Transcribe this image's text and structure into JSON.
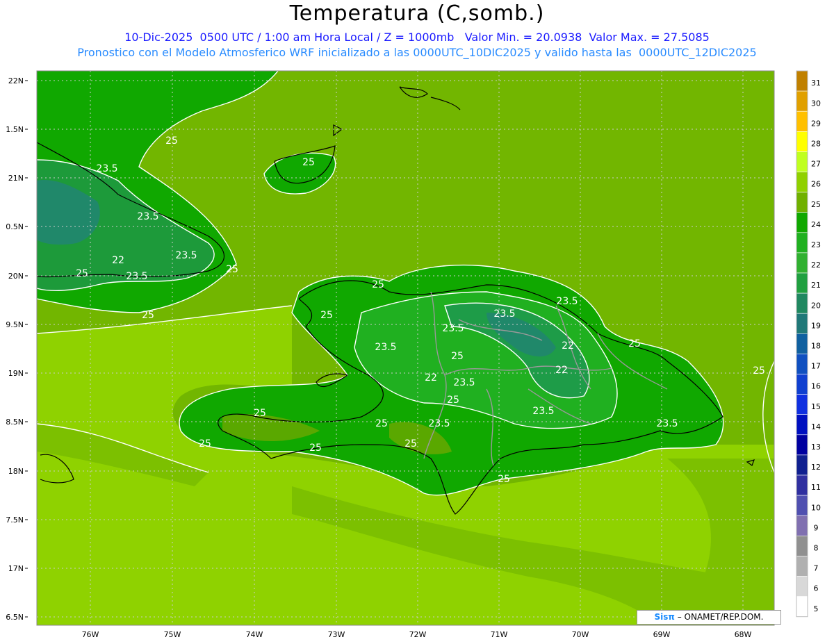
{
  "header": {
    "title": "Temperatura (C,somb.)",
    "line1": "10-Dic-2025  0500 UTC / 1:00 am Hora Local / Z = 1000mb   Valor Min. = 20.0938  Valor Max. = 27.5085",
    "line2": "Pronostico con el Modelo Atmosferico WRF inicializado a las 0000UTC_10DIC2025 y valido hasta las  0000UTC_12DIC2025"
  },
  "axes": {
    "lat_labels": [
      "22N",
      "1.5N",
      "21N",
      "0.5N",
      "20N",
      "9.5N",
      "19N",
      "8.5N",
      "18N",
      "7.5N",
      "17N",
      "6.5N"
    ],
    "lon_labels": [
      "76W",
      "75W",
      "74W",
      "73W",
      "72W",
      "71W",
      "70W",
      "69W",
      "68W"
    ]
  },
  "colorbar": {
    "labels": [
      "31",
      "30",
      "29",
      "28",
      "27",
      "26",
      "25",
      "24",
      "23",
      "22",
      "21",
      "20",
      "19",
      "18",
      "17",
      "16",
      "15",
      "14",
      "13",
      "12",
      "11",
      "10",
      "9",
      "8",
      "7",
      "6",
      "5"
    ],
    "colors": [
      "#c08000",
      "#e0a000",
      "#ffc000",
      "#ffff00",
      "#c0ff20",
      "#90d000",
      "#70b000",
      "#10a800",
      "#20b020",
      "#30b030",
      "#20a040",
      "#208860",
      "#207878",
      "#1060a0",
      "#1050c0",
      "#1040d0",
      "#1030e0",
      "#0010c0",
      "#0000a0",
      "#102090",
      "#3030a0",
      "#5050b0",
      "#8070b0",
      "#909090",
      "#b0b0b0",
      "#d8d8d8",
      "#ffffff"
    ]
  },
  "contour_labels": [
    {
      "text": "25"
    },
    {
      "text": "25"
    },
    {
      "text": "23.5"
    },
    {
      "text": "23.5"
    },
    {
      "text": "23.5"
    },
    {
      "text": "22"
    },
    {
      "text": "23.5"
    },
    {
      "text": "25"
    },
    {
      "text": "25"
    },
    {
      "text": "25"
    },
    {
      "text": "25"
    },
    {
      "text": "25"
    },
    {
      "text": "23.5"
    },
    {
      "text": "23.5"
    },
    {
      "text": "23.5"
    },
    {
      "text": "23.5"
    },
    {
      "text": "22"
    },
    {
      "text": "22"
    },
    {
      "text": "25"
    },
    {
      "text": "22"
    },
    {
      "text": "23.5"
    },
    {
      "text": "25"
    },
    {
      "text": "25"
    },
    {
      "text": "25"
    },
    {
      "text": "23.5"
    },
    {
      "text": "23.5"
    },
    {
      "text": "23.5"
    },
    {
      "text": "25"
    },
    {
      "text": "25"
    },
    {
      "text": "25"
    },
    {
      "text": "25"
    },
    {
      "text": "25"
    },
    {
      "text": "25"
    }
  ],
  "credit": {
    "logo": "Sisπ",
    "text": " – ONAMET/REP.DOM."
  }
}
